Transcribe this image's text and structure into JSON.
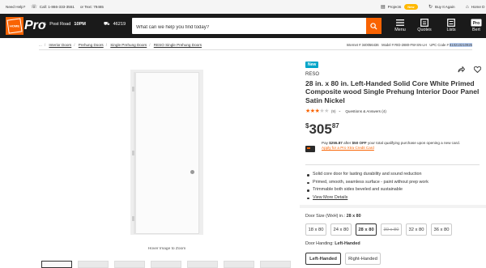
{
  "utility": {
    "need_help": "Need Help?",
    "call": "Call: 1-866-333-3551",
    "or_text": "or Text: 79465",
    "projects": "Projects",
    "new_badge": "New",
    "buy_again": "Buy It Again",
    "home": "Home D"
  },
  "header": {
    "logo_text": "Pro",
    "store_name": "Post Road",
    "store_hours": "10PM",
    "zip": "46219",
    "search_placeholder": "What can we help you find today?",
    "nav": [
      {
        "label": "Menu",
        "icon": "menu-icon"
      },
      {
        "label": "Quotes",
        "icon": "quotes-icon"
      },
      {
        "label": "Lists",
        "icon": "list-icon"
      },
      {
        "label": "Bert",
        "icon": "account-icon"
      }
    ]
  },
  "breadcrumbs": [
    "...",
    "Interior Doors",
    "Prehung Doors",
    "Single Prehung Doors",
    "RESO Single Prehung Doors"
  ],
  "product_ids": {
    "internet": "Internet # 340056436",
    "model": "Model # RID-2880-FW-SN-LH",
    "upc_label": "UPC Code #",
    "upc_value": "810210210925"
  },
  "media": {
    "zoom_text": "Hover Image to Zoom"
  },
  "product": {
    "badge": "New",
    "brand": "RESO",
    "title": "28 in. x 80 in. Left-Handed Solid Core White Primed Composite wood Single Prehung Interior Door Panel Satin Nickel",
    "rating_stars": 3,
    "rating_count": "(9)",
    "qa": "Questions & Answers (4)",
    "price_symbol": "$",
    "price_dollars": "305",
    "price_cents": "87"
  },
  "credit": {
    "pay_prefix": "Pay",
    "pay_amount": "$255.87",
    "pay_after": "after",
    "discount": "$50 OFF",
    "pay_suffix": "your total qualifying purchase upon opening a new card.",
    "apply_link": "Apply for a Pro Xtra Credit Card"
  },
  "features": [
    "Solid core door for lasting durability and sound reduction",
    "Primed, smooth, seamless surface - paint without prep work",
    "Trimmable both sides beveled and sustainable"
  ],
  "more_details": "View More Details",
  "door_size": {
    "label": "Door Size (WxH) in.:",
    "selected": "28 x 80",
    "options": [
      "18 x 80",
      "24 x 80",
      "28 x 80",
      "30 x 80",
      "32 x 80",
      "36 x 80"
    ]
  },
  "door_handing": {
    "label": "Door Handing:",
    "selected": "Left-Handed",
    "options": [
      "Left-Handed",
      "Right-Handed"
    ]
  }
}
